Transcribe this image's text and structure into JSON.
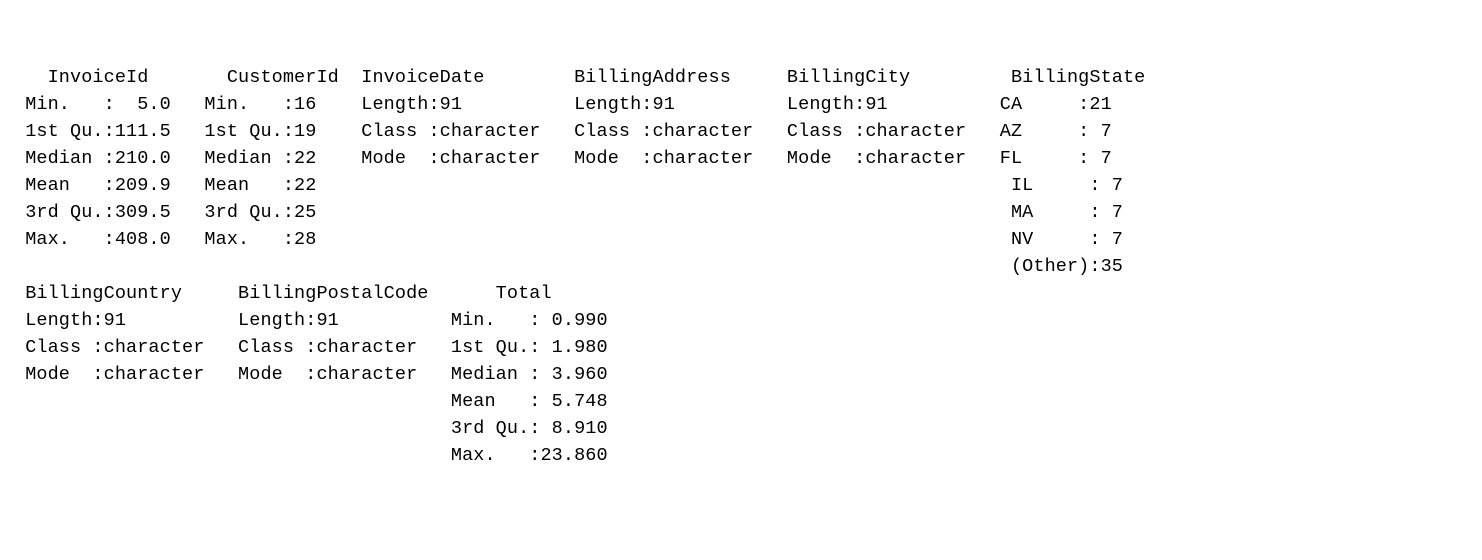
{
  "summary": {
    "block1": {
      "InvoiceId": {
        "header": "  InvoiceId    ",
        "rows": [
          "Min.   :  5.0  ",
          "1st Qu.:111.5  ",
          "Median :210.0  ",
          "Mean   :209.9  ",
          "3rd Qu.:309.5  ",
          "Max.   :408.0  ",
          "               "
        ]
      },
      "CustomerId": {
        "header": "  CustomerId ",
        "rows": [
          "Min.   :16   ",
          "1st Qu.:19   ",
          "Median :22   ",
          "Mean   :22   ",
          "3rd Qu.:25   ",
          "Max.   :28   ",
          "             "
        ]
      },
      "InvoiceDate": {
        "header": "InvoiceDate       ",
        "rows": [
          "Length:91         ",
          "Class :character  ",
          "Mode  :character  ",
          "                  ",
          "                  ",
          "                  ",
          "                  "
        ]
      },
      "BillingAddress": {
        "header": "BillingAddress    ",
        "rows": [
          "Length:91         ",
          "Class :character  ",
          "Mode  :character  ",
          "                  ",
          "                  ",
          "                  ",
          "                  "
        ]
      },
      "BillingCity": {
        "header": "BillingCity       ",
        "rows": [
          "Length:91         ",
          "Class :character  ",
          "Mode  :character  ",
          "                  ",
          "                  ",
          "                  ",
          "                  "
        ]
      },
      "BillingState": {
        "header": " BillingState",
        "rows": [
          "CA     :21   ",
          "AZ     : 7   ",
          "FL     : 7   ",
          "IL     : 7   ",
          "MA     : 7   ",
          "NV     : 7   ",
          "(Other):35   "
        ]
      }
    },
    "block2": {
      "BillingCountry": {
        "header": "BillingCountry    ",
        "rows": [
          "Length:91         ",
          "Class :character  ",
          "Mode  :character  ",
          "                  ",
          "                  ",
          "                  "
        ]
      },
      "BillingPostalCode": {
        "header": "BillingPostalCode ",
        "rows": [
          "Length:91         ",
          "Class :character  ",
          "Mode  :character  ",
          "                  ",
          "                  ",
          "                  "
        ]
      },
      "Total": {
        "header": "    Total       ",
        "rows": [
          "Min.   : 0.990  ",
          "1st Qu.: 1.980  ",
          "Median : 3.960  ",
          "Mean   : 5.748  ",
          "3rd Qu.: 8.910  ",
          "Max.   :23.860  "
        ]
      }
    }
  },
  "নlines": {
    "l01": "   InvoiceId       CustomerId  InvoiceDate        BillingAddress     BillingCity         BillingState",
    "l02": " Min.   :  5.0   Min.   :16    Length:91          Length:91          Length:91          CA     :21   ",
    "l03": " 1st Qu.:111.5   1st Qu.:19    Class :character   Class :character   Class :character   AZ     : 7   ",
    "l04": " Median :210.0   Median :22    Mode  :character   Mode  :character   Mode  :character   FL     : 7   ",
    "l05": " Mean   :209.9   Mean   :22                                                              IL     : 7   ",
    "l06": " 3rd Qu.:309.5   3rd Qu.:25                                                              MA     : 7   ",
    "l07": " Max.   :408.0   Max.   :28                                                              NV     : 7   ",
    "l08": "                                                                                         (Other):35   ",
    "l09": " BillingCountry     BillingPostalCode      Total       ",
    "l10": " Length:91          Length:91          Min.   : 0.990  ",
    "l11": " Class :character   Class :character   1st Qu.: 1.980  ",
    "l12": " Mode  :character   Mode  :character   Median : 3.960  ",
    "l13": "                                       Mean   : 5.748  ",
    "l14": "                                       3rd Qu.: 8.910  ",
    "l15": "                                       Max.   :23.860  "
  }
}
